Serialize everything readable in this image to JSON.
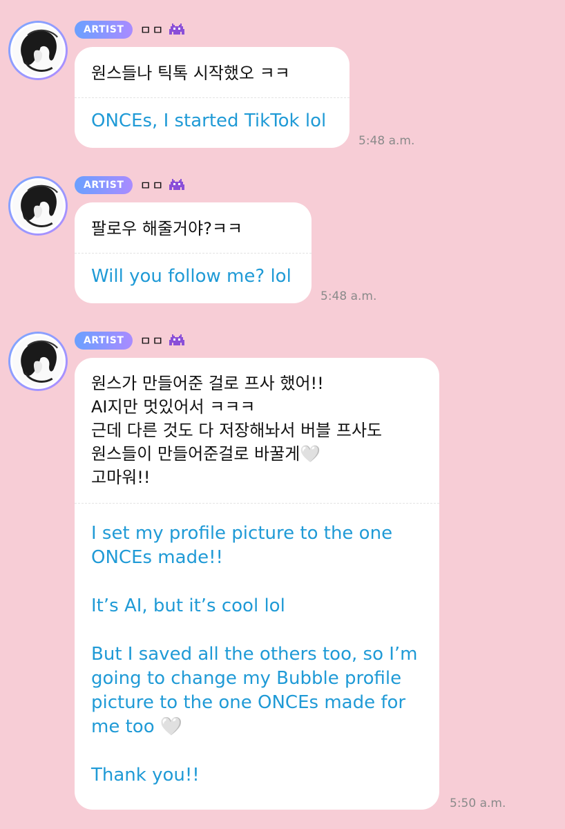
{
  "colors": {
    "background": "#f7cdd6",
    "bubble": "#ffffff",
    "korean_text": "#111111",
    "english_text": "#1f9ad6",
    "timestamp": "#8a8a8a",
    "badge_gradient_start": "#6aa0ff",
    "badge_gradient_end": "#a98bff"
  },
  "messages": [
    {
      "badge": "ARTIST",
      "name": "ㅁㅁ",
      "name_icon": "alien-monster-icon",
      "avatar_icon": "profile-sketch-avatar",
      "korean": "원스들나 틱톡 시작했오 ㅋㅋ",
      "english": "ONCEs, I started TikTok lol",
      "time": "5:48 a.m."
    },
    {
      "badge": "ARTIST",
      "name": "ㅁㅁ",
      "name_icon": "alien-monster-icon",
      "avatar_icon": "profile-sketch-avatar",
      "korean": "팔로우 해줄거야?ㅋㅋ",
      "english": "Will you follow me? lol",
      "time": "5:48 a.m."
    },
    {
      "badge": "ARTIST",
      "name": "ㅁㅁ",
      "name_icon": "alien-monster-icon",
      "avatar_icon": "profile-sketch-avatar",
      "korean": "원스가 만들어준 걸로 프사 했어!!\nAI지만  멋있어서 ㅋㅋㅋ\n근데 다른 것도 다 저장해놔서 버블 프사도\n원스들이 만들어준걸로 바꿀게🤍\n고마워!!",
      "english": "I set my profile picture to the one ONCEs made!!\n\nIt’s AI, but it’s cool lol\n\nBut I saved all the others too, so I’m going to change my Bubble profile picture to the one ONCEs made for me too 🤍\n\nThank you!!",
      "time": "5:50 a.m."
    }
  ]
}
